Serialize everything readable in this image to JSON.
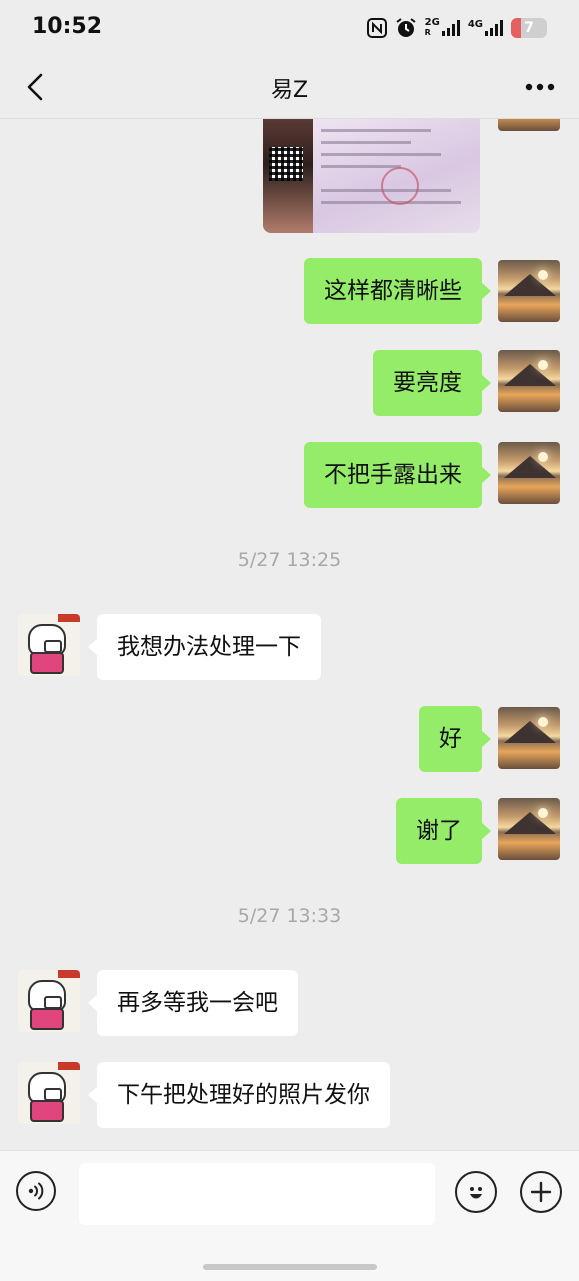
{
  "status_bar": {
    "time": "10:52",
    "network_1": "2G",
    "network_1_sub": "R",
    "network_2": "4G",
    "battery_level": "7",
    "battery_color": "#e5605e",
    "icons": [
      "nfc-icon",
      "alarm-icon",
      "signal-2g-icon",
      "signal-4g-icon",
      "battery-icon"
    ]
  },
  "header": {
    "title": "易Z",
    "back_icon": "chevron-left-icon",
    "more_icon": "more-dots-icon"
  },
  "messages": [
    {
      "type": "image",
      "sender": "me"
    },
    {
      "type": "text",
      "sender": "me",
      "text": "这样都清晰些"
    },
    {
      "type": "text",
      "sender": "me",
      "text": "要亮度"
    },
    {
      "type": "text",
      "sender": "me",
      "text": "不把手露出来"
    },
    {
      "type": "time",
      "text": "5/27 13:25"
    },
    {
      "type": "text",
      "sender": "other",
      "text": "我想办法处理一下"
    },
    {
      "type": "text",
      "sender": "me",
      "text": "好"
    },
    {
      "type": "text",
      "sender": "me",
      "text": "谢了"
    },
    {
      "type": "time",
      "text": "5/27 13:33"
    },
    {
      "type": "text",
      "sender": "other",
      "text": "再多等我一会吧"
    },
    {
      "type": "text",
      "sender": "other",
      "text": "下午把处理好的照片发你"
    }
  ],
  "input_bar": {
    "value": "",
    "voice_icon": "voice-icon",
    "emoji_icon": "emoji-icon",
    "plus_icon": "plus-icon"
  },
  "colors": {
    "background": "#ededed",
    "my_bubble": "#95ec69",
    "their_bubble": "#ffffff",
    "timestamp_text": "#a8a8a8"
  }
}
